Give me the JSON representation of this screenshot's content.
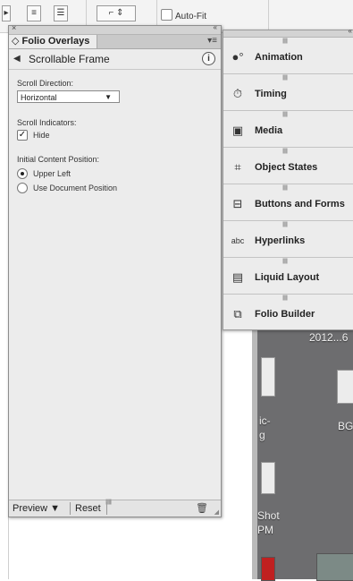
{
  "toolbar": {
    "autofit_label": "Auto-Fit"
  },
  "panel": {
    "tab_label": "◇ Folio Overlays",
    "frame_title": "Scrollable Frame",
    "scroll_direction": {
      "label": "Scroll Direction:",
      "value": "Horizontal"
    },
    "scroll_indicators": {
      "label": "Scroll Indicators:",
      "hide_label": "Hide",
      "hide_checked": true
    },
    "initial_position": {
      "label": "Initial Content Position:",
      "options": [
        "Upper Left",
        "Use Document Position"
      ],
      "selected": "Upper Left"
    },
    "footer": {
      "preview_label": "Preview ▼",
      "reset_label": "Reset"
    }
  },
  "stack": {
    "items": [
      {
        "label": "Animation",
        "icon": "animation-icon"
      },
      {
        "label": "Timing",
        "icon": "timing-icon"
      },
      {
        "label": "Media",
        "icon": "media-icon"
      },
      {
        "label": "Object States",
        "icon": "object-states-icon"
      },
      {
        "label": "Buttons and Forms",
        "icon": "buttons-and-forms-icon"
      },
      {
        "label": "Hyperlinks",
        "icon": "hyperlinks-icon"
      },
      {
        "label": "Liquid Layout",
        "icon": "liquid-layout-icon"
      },
      {
        "label": "Folio Builder",
        "icon": "folio-builder-icon"
      }
    ]
  },
  "desktop": {
    "labels": [
      "2012...6",
      "BG",
      "ic-",
      "g",
      "Shot",
      "PM"
    ]
  }
}
